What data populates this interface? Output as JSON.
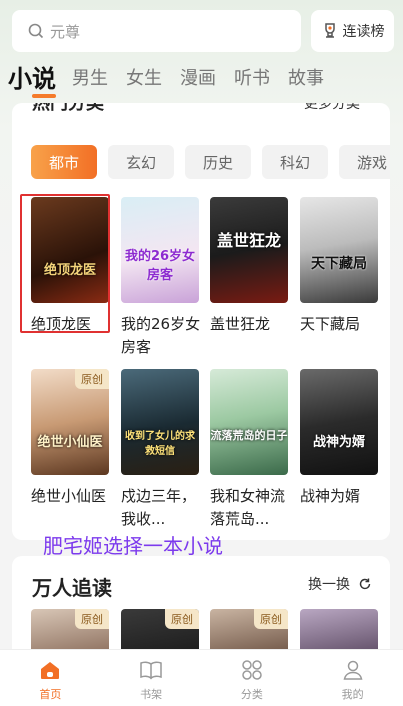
{
  "search": {
    "placeholder": "元尊",
    "rank_button": "连读榜"
  },
  "tabs": [
    {
      "label": "小说",
      "active": true
    },
    {
      "label": "男生"
    },
    {
      "label": "女生"
    },
    {
      "label": "漫画"
    },
    {
      "label": "听书"
    },
    {
      "label": "故事"
    }
  ],
  "hot": {
    "title_partial": "热门分类",
    "more_partial": "更多分类",
    "chips": [
      "都市",
      "玄幻",
      "历史",
      "科幻",
      "游戏"
    ],
    "books": [
      {
        "title": "绝顶龙医",
        "cover_text": "绝顶龙医",
        "tag": ""
      },
      {
        "title": "我的26岁女房客",
        "cover_text": "我的26岁女房客",
        "tag": ""
      },
      {
        "title": "盖世狂龙",
        "cover_text": "盖世狂龙",
        "tag": ""
      },
      {
        "title": "天下藏局",
        "cover_text": "天下藏局",
        "tag": ""
      },
      {
        "title": "绝世小仙医",
        "cover_text": "绝世小仙医",
        "tag": "原创"
      },
      {
        "title": "戍边三年，我收...",
        "cover_text": "收到了女儿的求救短信",
        "tag": ""
      },
      {
        "title": "我和女神流落荒岛...",
        "cover_text": "流落荒岛的日子",
        "tag": ""
      },
      {
        "title": "战神为婿",
        "cover_text": "战神为婿",
        "tag": ""
      }
    ]
  },
  "annotation": "肥宅姬选择一本小说",
  "wanren": {
    "title": "万人追读",
    "refresh": "换一换",
    "tags": [
      "原创",
      "原创",
      "原创",
      ""
    ]
  },
  "bottom_nav": [
    {
      "label": "首页",
      "icon": "home-icon",
      "active": true
    },
    {
      "label": "书架",
      "icon": "bookshelf-icon"
    },
    {
      "label": "分类",
      "icon": "category-icon"
    },
    {
      "label": "我的",
      "icon": "profile-icon"
    }
  ],
  "colors": {
    "accent": "#f26f25",
    "annotation": "#7c3aed",
    "highlight": "#e03131"
  }
}
